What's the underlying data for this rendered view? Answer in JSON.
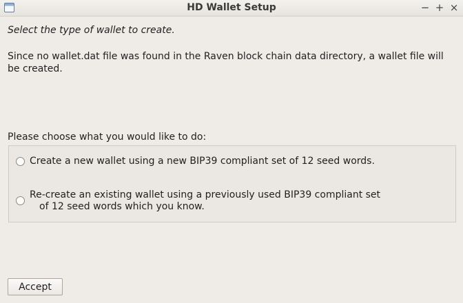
{
  "window": {
    "title": "HD Wallet Setup",
    "icon": "window-icon",
    "controls": {
      "minimize": "−",
      "maximize": "+",
      "close": "×"
    }
  },
  "prompt": "Select the type of wallet to create.",
  "info": "Since no wallet.dat file was found in the Raven block chain data directory, a wallet file will be created.",
  "choose_label": "Please choose what you would like to do:",
  "options": [
    {
      "label": "Create a new wallet using a new BIP39 compliant set of 12 seed words.",
      "selected": false
    },
    {
      "label_line1": "Re-create an existing wallet using a previously used BIP39 compliant set",
      "label_line2": "of 12 seed words which you know.",
      "selected": false
    }
  ],
  "accept_label": "Accept"
}
